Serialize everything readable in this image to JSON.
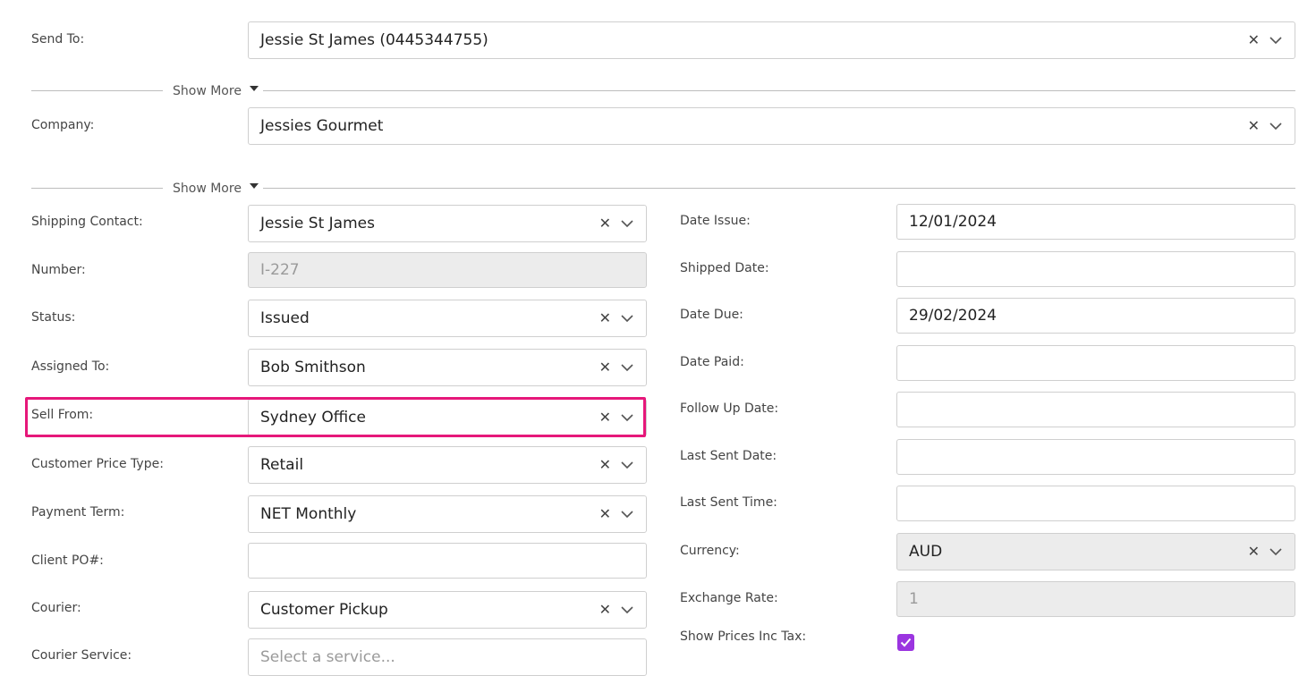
{
  "send_to": {
    "label": "Send To:",
    "value": "Jessie St James (0445344755)"
  },
  "show_more_1": "Show More",
  "company": {
    "label": "Company:",
    "value": "Jessies Gourmet"
  },
  "show_more_2": "Show More",
  "left": {
    "shipping_contact": {
      "label": "Shipping Contact:",
      "value": "Jessie St James"
    },
    "number": {
      "label": "Number:",
      "value": "I-227"
    },
    "status": {
      "label": "Status:",
      "value": "Issued"
    },
    "assigned_to": {
      "label": "Assigned To:",
      "value": "Bob Smithson"
    },
    "sell_from": {
      "label": "Sell From:",
      "value": "Sydney Office"
    },
    "customer_price_type": {
      "label": "Customer Price Type:",
      "value": "Retail"
    },
    "payment_term": {
      "label": "Payment Term:",
      "value": "NET Monthly"
    },
    "client_po": {
      "label": "Client PO#:",
      "value": ""
    },
    "courier": {
      "label": "Courier:",
      "value": "Customer Pickup"
    },
    "courier_service": {
      "label": "Courier Service:",
      "placeholder": "Select a service..."
    }
  },
  "right": {
    "date_issue": {
      "label": "Date Issue:",
      "value": "12/01/2024"
    },
    "shipped_date": {
      "label": "Shipped Date:",
      "value": ""
    },
    "date_due": {
      "label": "Date Due:",
      "value": "29/02/2024"
    },
    "date_paid": {
      "label": "Date Paid:",
      "value": ""
    },
    "follow_up_date": {
      "label": "Follow Up Date:",
      "value": ""
    },
    "last_sent_date": {
      "label": "Last Sent Date:",
      "value": ""
    },
    "last_sent_time": {
      "label": "Last Sent Time:",
      "value": ""
    },
    "currency": {
      "label": "Currency:",
      "value": "AUD"
    },
    "exchange_rate": {
      "label": "Exchange Rate:",
      "value": "1"
    },
    "show_prices_inc_tax": {
      "label": "Show Prices Inc Tax:",
      "checked": true
    }
  },
  "colors": {
    "highlight": "#e6177a",
    "checkbox": "#9b35e0",
    "disabled_bg": "#ececec"
  },
  "icons": {
    "clear": "clear-x-icon",
    "dropdown": "chevron-down-icon",
    "caret": "caret-down-icon",
    "check": "check-icon"
  }
}
